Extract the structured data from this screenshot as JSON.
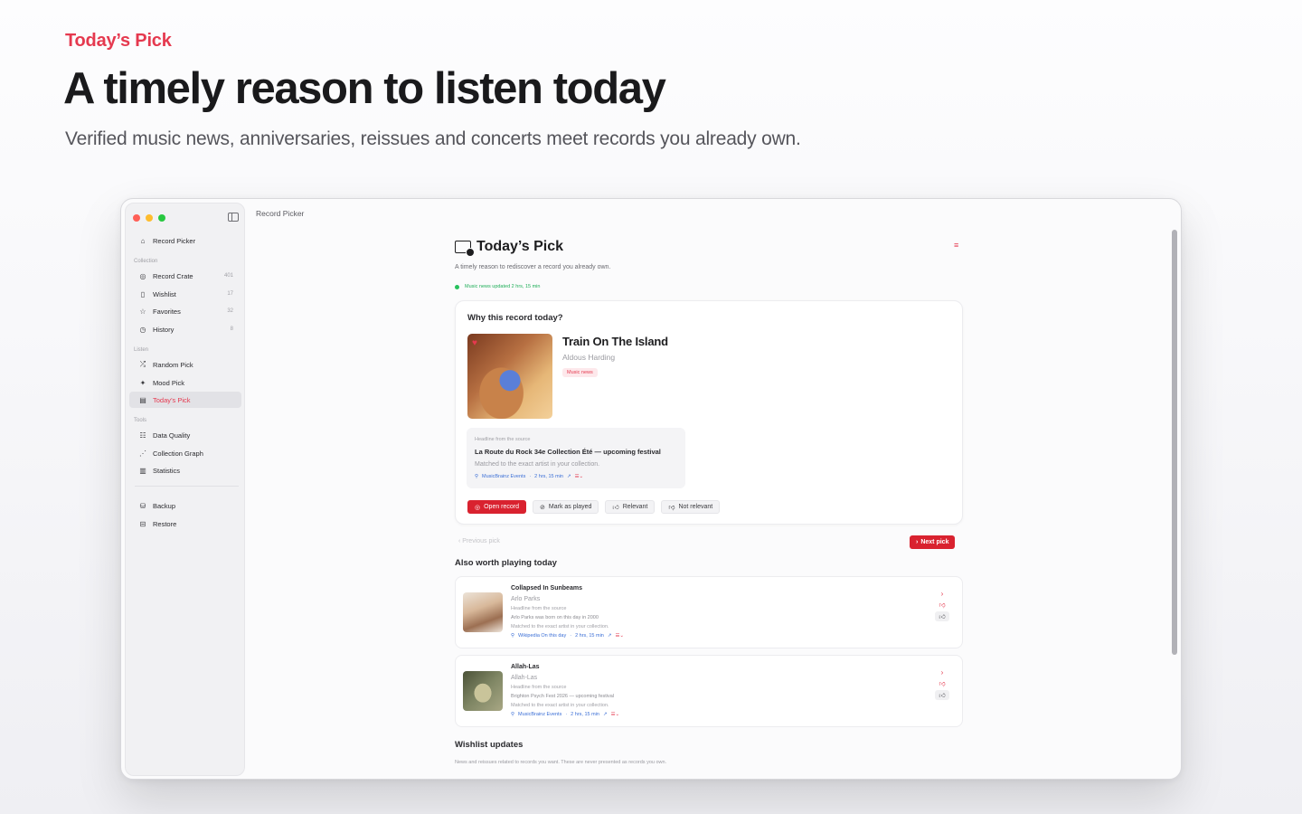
{
  "hero": {
    "eyebrow": "Today’s Pick",
    "title": "A timely reason to listen today",
    "subtitle": "Verified music news, anniversaries, reissues and concerts meet records you already own."
  },
  "window": {
    "title": "Record Picker"
  },
  "sidebar": {
    "home": "Record Picker",
    "sections": {
      "collection": "Collection",
      "listen": "Listen",
      "tools": "Tools"
    },
    "collection_items": [
      {
        "label": "Record Crate",
        "count": "401",
        "icon": "record-icon"
      },
      {
        "label": "Wishlist",
        "count": "17",
        "icon": "bookmark-icon"
      },
      {
        "label": "Favorites",
        "count": "32",
        "icon": "star-icon"
      },
      {
        "label": "History",
        "count": "8",
        "icon": "history-icon"
      }
    ],
    "listen_items": [
      {
        "label": "Random Pick",
        "icon": "shuffle-icon"
      },
      {
        "label": "Mood Pick",
        "icon": "sparkle-icon"
      },
      {
        "label": "Today’s Pick",
        "icon": "calendar-icon"
      }
    ],
    "tools_items": [
      {
        "label": "Data Quality",
        "icon": "checklist-icon"
      },
      {
        "label": "Collection Graph",
        "icon": "graph-icon"
      },
      {
        "label": "Statistics",
        "icon": "chart-icon"
      }
    ],
    "backup_items": [
      {
        "label": "Backup",
        "icon": "drive-icon"
      },
      {
        "label": "Restore",
        "icon": "archive-icon"
      }
    ]
  },
  "page": {
    "title": "Today’s Pick",
    "subtitle": "A timely reason to rediscover a record you already own.",
    "status": "Music news updated 2 hrs, 15 min"
  },
  "pick": {
    "heading": "Why this record today?",
    "record_title": "Train On The Island",
    "artist": "Aldous Harding",
    "tag": "Music news",
    "headline_label": "Headline from the source",
    "headline": "La Route du Rock 34e Collection Été — upcoming festival",
    "match": "Matched to the exact artist in your collection.",
    "source": "MusicBrainz Events",
    "age": "2 hrs, 15 min",
    "actions": {
      "open": "Open record",
      "played": "Mark as played",
      "relevant": "Relevant",
      "not_relevant": "Not relevant"
    }
  },
  "nav": {
    "prev": "Previous pick",
    "next": "Next pick"
  },
  "also": {
    "heading": "Also worth playing today",
    "items": [
      {
        "title": "Collapsed In Sunbeams",
        "artist": "Arlo Parks",
        "label": "Headline from the source",
        "headline": "Arlo Parks was born on this day in 2000",
        "match": "Matched to the exact artist in your collection.",
        "source": "Wikipedia On this day",
        "age": "2 hrs, 15 min"
      },
      {
        "title": "Allah-Las",
        "artist": "Allah-Las",
        "label": "Headline from the source",
        "headline": "Brighton Psych Fest 2026 — upcoming festival",
        "match": "Matched to the exact artist in your collection.",
        "source": "MusicBrainz Events",
        "age": "2 hrs, 15 min"
      }
    ]
  },
  "wishlist": {
    "heading": "Wishlist updates",
    "subtitle": "News and reissues related to records you want. These are never presented as records you own."
  },
  "colors": {
    "accent": "#e5394f",
    "primary_button": "#d9222f",
    "link": "#3b6fd6",
    "status": "#27c15d"
  }
}
